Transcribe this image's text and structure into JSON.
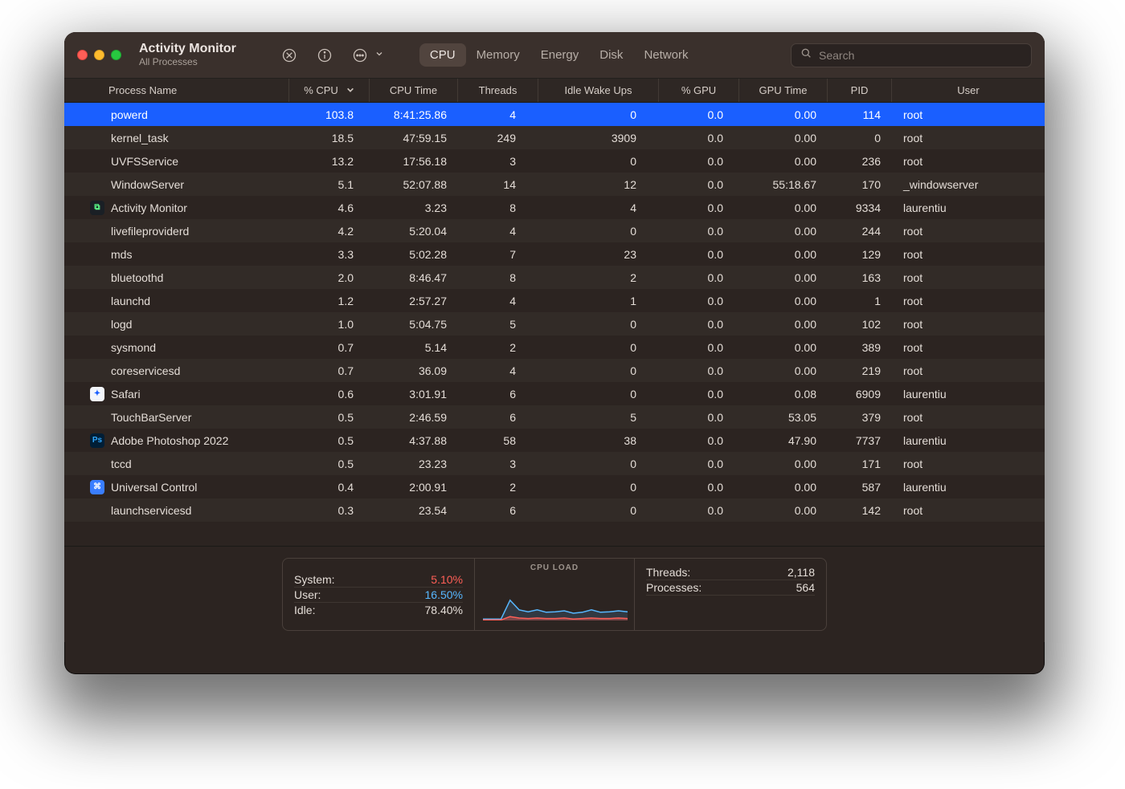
{
  "window": {
    "title": "Activity Monitor",
    "subtitle": "All Processes"
  },
  "toolbar": {
    "search_placeholder": "Search"
  },
  "tabs": [
    {
      "label": "CPU",
      "active": true
    },
    {
      "label": "Memory",
      "active": false
    },
    {
      "label": "Energy",
      "active": false
    },
    {
      "label": "Disk",
      "active": false
    },
    {
      "label": "Network",
      "active": false
    }
  ],
  "columns": {
    "name": "Process Name",
    "cpu": "% CPU",
    "cputime": "CPU Time",
    "threads": "Threads",
    "idle": "Idle Wake Ups",
    "gpu": "% GPU",
    "gputime": "GPU Time",
    "pid": "PID",
    "user": "User"
  },
  "sorted_column": "cpu",
  "sort_direction": "desc",
  "processes": [
    {
      "icon": null,
      "name": "powerd",
      "cpu": "103.8",
      "cputime": "8:41:25.86",
      "threads": "4",
      "idle": "0",
      "gpu": "0.0",
      "gputime": "0.00",
      "pid": "114",
      "user": "root",
      "selected": true
    },
    {
      "icon": null,
      "name": "kernel_task",
      "cpu": "18.5",
      "cputime": "47:59.15",
      "threads": "249",
      "idle": "3909",
      "gpu": "0.0",
      "gputime": "0.00",
      "pid": "0",
      "user": "root",
      "selected": false
    },
    {
      "icon": null,
      "name": "UVFSService",
      "cpu": "13.2",
      "cputime": "17:56.18",
      "threads": "3",
      "idle": "0",
      "gpu": "0.0",
      "gputime": "0.00",
      "pid": "236",
      "user": "root",
      "selected": false
    },
    {
      "icon": null,
      "name": "WindowServer",
      "cpu": "5.1",
      "cputime": "52:07.88",
      "threads": "14",
      "idle": "12",
      "gpu": "0.0",
      "gputime": "55:18.67",
      "pid": "170",
      "user": "_windowserver",
      "selected": false
    },
    {
      "icon": "am",
      "name": "Activity Monitor",
      "cpu": "4.6",
      "cputime": "3.23",
      "threads": "8",
      "idle": "4",
      "gpu": "0.0",
      "gputime": "0.00",
      "pid": "9334",
      "user": "laurentiu",
      "selected": false
    },
    {
      "icon": null,
      "name": "livefileproviderd",
      "cpu": "4.2",
      "cputime": "5:20.04",
      "threads": "4",
      "idle": "0",
      "gpu": "0.0",
      "gputime": "0.00",
      "pid": "244",
      "user": "root",
      "selected": false
    },
    {
      "icon": null,
      "name": "mds",
      "cpu": "3.3",
      "cputime": "5:02.28",
      "threads": "7",
      "idle": "23",
      "gpu": "0.0",
      "gputime": "0.00",
      "pid": "129",
      "user": "root",
      "selected": false
    },
    {
      "icon": null,
      "name": "bluetoothd",
      "cpu": "2.0",
      "cputime": "8:46.47",
      "threads": "8",
      "idle": "2",
      "gpu": "0.0",
      "gputime": "0.00",
      "pid": "163",
      "user": "root",
      "selected": false
    },
    {
      "icon": null,
      "name": "launchd",
      "cpu": "1.2",
      "cputime": "2:57.27",
      "threads": "4",
      "idle": "1",
      "gpu": "0.0",
      "gputime": "0.00",
      "pid": "1",
      "user": "root",
      "selected": false
    },
    {
      "icon": null,
      "name": "logd",
      "cpu": "1.0",
      "cputime": "5:04.75",
      "threads": "5",
      "idle": "0",
      "gpu": "0.0",
      "gputime": "0.00",
      "pid": "102",
      "user": "root",
      "selected": false
    },
    {
      "icon": null,
      "name": "sysmond",
      "cpu": "0.7",
      "cputime": "5.14",
      "threads": "2",
      "idle": "0",
      "gpu": "0.0",
      "gputime": "0.00",
      "pid": "389",
      "user": "root",
      "selected": false
    },
    {
      "icon": null,
      "name": "coreservicesd",
      "cpu": "0.7",
      "cputime": "36.09",
      "threads": "4",
      "idle": "0",
      "gpu": "0.0",
      "gputime": "0.00",
      "pid": "219",
      "user": "root",
      "selected": false
    },
    {
      "icon": "safari",
      "name": "Safari",
      "cpu": "0.6",
      "cputime": "3:01.91",
      "threads": "6",
      "idle": "0",
      "gpu": "0.0",
      "gputime": "0.08",
      "pid": "6909",
      "user": "laurentiu",
      "selected": false
    },
    {
      "icon": null,
      "name": "TouchBarServer",
      "cpu": "0.5",
      "cputime": "2:46.59",
      "threads": "6",
      "idle": "5",
      "gpu": "0.0",
      "gputime": "53.05",
      "pid": "379",
      "user": "root",
      "selected": false
    },
    {
      "icon": "ps",
      "name": "Adobe Photoshop 2022",
      "cpu": "0.5",
      "cputime": "4:37.88",
      "threads": "58",
      "idle": "38",
      "gpu": "0.0",
      "gputime": "47.90",
      "pid": "7737",
      "user": "laurentiu",
      "selected": false
    },
    {
      "icon": null,
      "name": "tccd",
      "cpu": "0.5",
      "cputime": "23.23",
      "threads": "3",
      "idle": "0",
      "gpu": "0.0",
      "gputime": "0.00",
      "pid": "171",
      "user": "root",
      "selected": false
    },
    {
      "icon": "uc",
      "name": "Universal Control",
      "cpu": "0.4",
      "cputime": "2:00.91",
      "threads": "2",
      "idle": "0",
      "gpu": "0.0",
      "gputime": "0.00",
      "pid": "587",
      "user": "laurentiu",
      "selected": false
    },
    {
      "icon": null,
      "name": "launchservicesd",
      "cpu": "0.3",
      "cputime": "23.54",
      "threads": "6",
      "idle": "0",
      "gpu": "0.0",
      "gputime": "0.00",
      "pid": "142",
      "user": "root",
      "selected": false
    }
  ],
  "footer": {
    "stats": {
      "system_label": "System:",
      "system_value": "5.10%",
      "user_label": "User:",
      "user_value": "16.50%",
      "idle_label": "Idle:",
      "idle_value": "78.40%"
    },
    "graph_title": "CPU LOAD",
    "right": {
      "threads_label": "Threads:",
      "threads_value": "2,118",
      "processes_label": "Processes:",
      "processes_value": "564"
    }
  },
  "chart_data": {
    "type": "area",
    "title": "CPU LOAD",
    "xlabel": "",
    "ylabel": "",
    "series": [
      {
        "name": "user",
        "color": "#57b7ff",
        "values": [
          3,
          3,
          3,
          42,
          22,
          18,
          22,
          17,
          18,
          20,
          15,
          17,
          22,
          17,
          18,
          20,
          18
        ]
      },
      {
        "name": "system",
        "color": "#ff5f57",
        "values": [
          1,
          1,
          1,
          8,
          5,
          4,
          5,
          4,
          4,
          5,
          3,
          4,
          5,
          4,
          4,
          5,
          4
        ]
      }
    ],
    "ylim": [
      0,
      100
    ]
  }
}
